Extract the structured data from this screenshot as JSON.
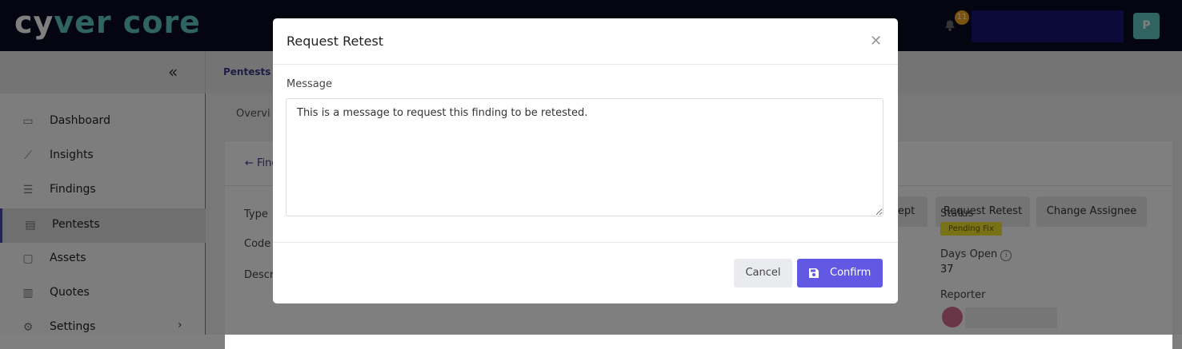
{
  "header": {
    "logo_prefix": "cy",
    "logo_rest": "ver core",
    "notification_count": "11",
    "user_initial": "P"
  },
  "breadcrumb": {
    "current": "Pentests"
  },
  "sidebar": {
    "items": [
      {
        "label": "Dashboard",
        "icon": "dashboard-icon"
      },
      {
        "label": "Insights",
        "icon": "chart-icon"
      },
      {
        "label": "Findings",
        "icon": "list-icon"
      },
      {
        "label": "Pentests",
        "icon": "folder-icon",
        "active": true
      },
      {
        "label": "Assets",
        "icon": "window-icon"
      },
      {
        "label": "Quotes",
        "icon": "quote-doc-icon"
      },
      {
        "label": "Settings",
        "icon": "gear-icon"
      }
    ]
  },
  "main": {
    "tab_partial": "Overvi",
    "back_partial": "← Find",
    "buttons": {
      "accept_partial": "cept",
      "request_retest": "Request Retest",
      "change_assignee": "Change Assignee"
    },
    "left_labels": [
      "Type",
      "Code",
      "Descr"
    ],
    "status_label": "Status",
    "status_value": "Pending Fix",
    "days_open_label": "Days Open",
    "days_open_value": "37",
    "reporter_label": "Reporter"
  },
  "modal": {
    "title": "Request Retest",
    "message_label": "Message",
    "message_value": "This is a message to request this finding to be retested.",
    "cancel_label": "Cancel",
    "confirm_label": "Confirm"
  },
  "colors": {
    "topbar": "#0b0b23",
    "accent": "#5fc8c6",
    "primary_button": "#6158e3",
    "status_badge": "#f3e22b"
  }
}
